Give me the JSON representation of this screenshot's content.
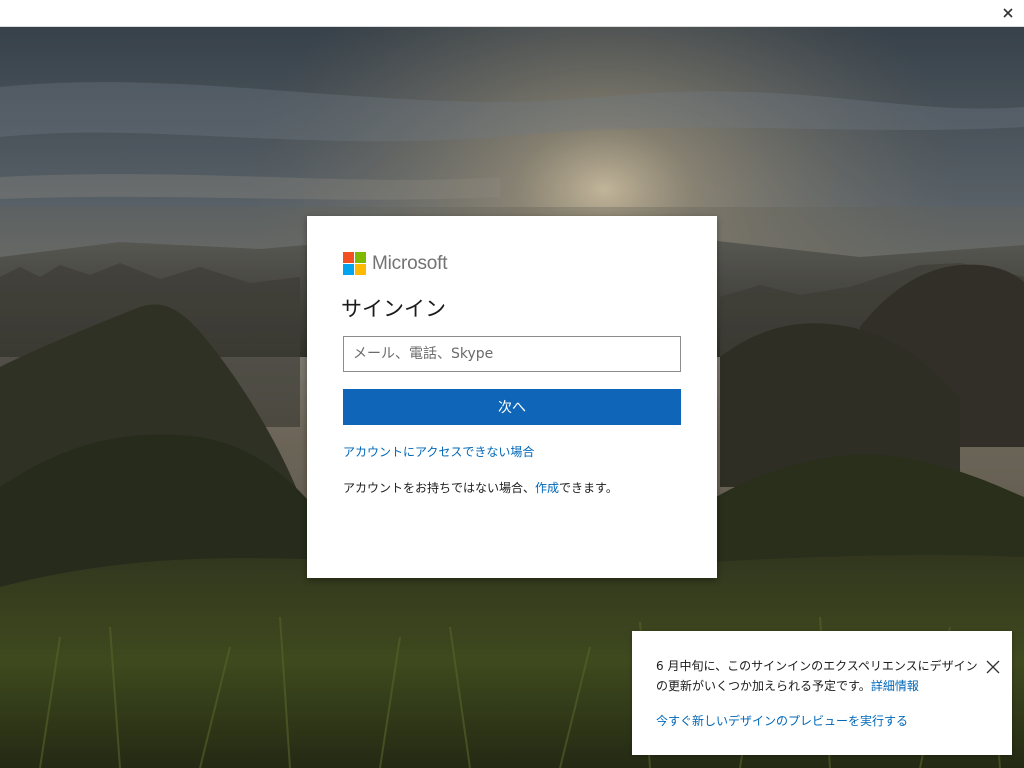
{
  "titlebar": {
    "close_icon": "close-icon"
  },
  "logo": {
    "text": "Microsoft",
    "colors": [
      "#f25022",
      "#7fba00",
      "#00a4ef",
      "#ffb900"
    ]
  },
  "signin": {
    "title": "サインイン",
    "email_placeholder": "メール、電話、Skype",
    "email_value": "",
    "next_label": "次へ",
    "cant_access_link": "アカウントにアクセスできない場合",
    "no_account_prefix": "アカウントをお持ちではない場合、",
    "create_link": "作成",
    "no_account_suffix": "できます。"
  },
  "notice": {
    "text": "6 月中旬に、このサインインのエクスペリエンスにデザインの更新がいくつか加えられる予定です。",
    "details_link": "詳細情報",
    "preview_link": "今すぐ新しいデザインのプレビューを実行する",
    "close_icon": "close-icon"
  },
  "colors": {
    "accent": "#0f66b8",
    "link": "#0067b8"
  }
}
